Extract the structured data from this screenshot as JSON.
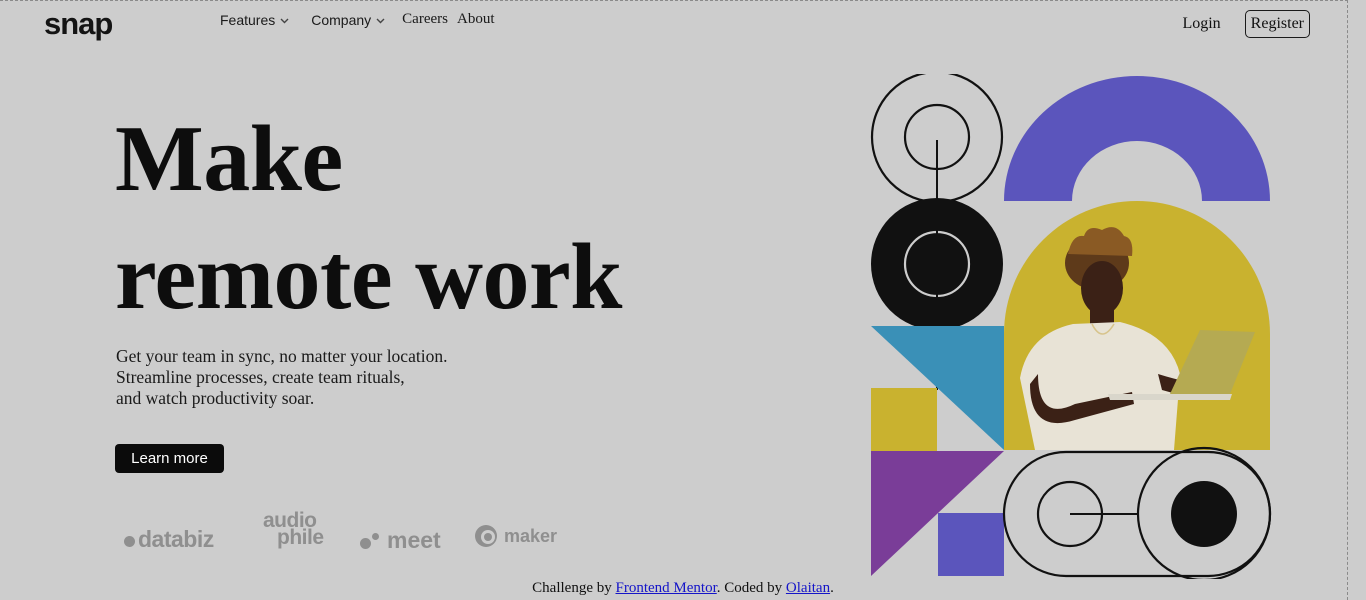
{
  "brand": {
    "logo": "snap"
  },
  "nav": {
    "links": [
      {
        "label": "Features",
        "has_dropdown": true
      },
      {
        "label": "Company",
        "has_dropdown": true
      },
      {
        "label": "Careers",
        "has_dropdown": false
      },
      {
        "label": "About",
        "has_dropdown": false
      }
    ],
    "login_label": "Login",
    "register_label": "Register"
  },
  "hero": {
    "headline_line1": "Make",
    "headline_line2": "remote work",
    "subtext_line1": "Get your team in sync, no matter your location.",
    "subtext_line2": "Streamline processes, create team rituals,",
    "subtext_line3": "and watch productivity soar.",
    "cta_label": "Learn more"
  },
  "clients": {
    "databiz": "databiz",
    "audiophile_line1": "audio",
    "audiophile_line2": "phile",
    "meet": "meet",
    "maker": "maker"
  },
  "footer": {
    "prefix": "Challenge by ",
    "link1": "Frontend Mentor",
    "middle": ". Coded by ",
    "link2": "Olaitan",
    "suffix": "."
  },
  "colors": {
    "background": "#cdcdcd",
    "purple": "#5b55bc",
    "yellow": "#c9b22f",
    "teal": "#3a90b7",
    "violet": "#7a3d98",
    "black": "#111111"
  },
  "icons": {
    "chevron": "chevron-down-icon",
    "hero_figure": "person-with-laptop-illustration"
  }
}
